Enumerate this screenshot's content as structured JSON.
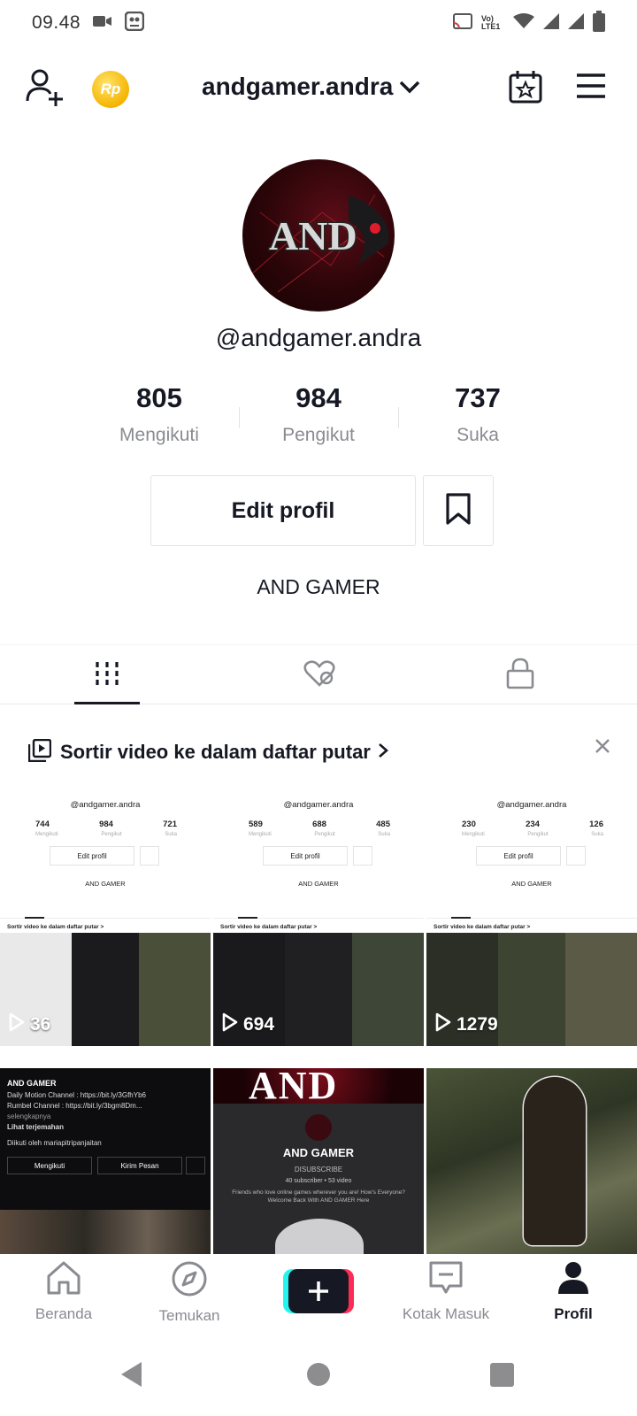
{
  "status_bar": {
    "time": "09.48",
    "network_label": "Vo) LTE1"
  },
  "header": {
    "username": "andgamer.andra",
    "coin_label": "Rp"
  },
  "profile": {
    "avatar_text": "AND",
    "handle": "@andgamer.andra",
    "stats": [
      {
        "value": "805",
        "label": "Mengikuti"
      },
      {
        "value": "984",
        "label": "Pengikut"
      },
      {
        "value": "737",
        "label": "Suka"
      }
    ],
    "edit_button_label": "Edit profil",
    "bio": "AND GAMER"
  },
  "playlist_banner": {
    "text": "Sortir video ke dalam daftar putar"
  },
  "videos": [
    {
      "views": "36",
      "mini": {
        "handle": "@andgamer.andra",
        "stats": [
          "744",
          "984",
          "721"
        ],
        "labels": [
          "Mengikuti",
          "Pengikut",
          "Suka"
        ],
        "edit": "Edit profil",
        "bio": "AND GAMER",
        "sort": "Sortir video ke dalam daftar putar >"
      }
    },
    {
      "views": "694",
      "mini": {
        "handle": "@andgamer.andra",
        "stats": [
          "589",
          "688",
          "485"
        ],
        "labels": [
          "Mengikuti",
          "Pengikut",
          "Suka"
        ],
        "edit": "Edit profil",
        "bio": "AND GAMER",
        "sort": "Sortir video ke dalam daftar putar >"
      }
    },
    {
      "views": "1279",
      "mini": {
        "handle": "@andgamer.andra",
        "stats": [
          "230",
          "234",
          "126"
        ],
        "labels": [
          "Mengikuti",
          "Pengikut",
          "Suka"
        ],
        "edit": "Edit profil",
        "bio": "AND GAMER",
        "sort": "Sortir video ke dalam daftar putar >"
      }
    },
    {
      "channel": {
        "title": "AND GAMER",
        "lines": [
          "Daily Motion Channel : https://bit.ly/3GfhYb6",
          "Rumbel Channel : https://bit.ly/3bgm8Dm...",
          "selengkapnya",
          "Lihat terjemahan",
          "Diikuti oleh mariapitripanjaitan"
        ],
        "follow_label": "Mengikuti",
        "message_label": "Kirim Pesan"
      }
    },
    {
      "yt": {
        "banner_text": "AND",
        "name": "AND GAMER",
        "subscribe": "DISUBSCRIBE",
        "counts": "40 subscriber • 53 video",
        "about": "Friends who love online games wherever you are! How's Everyone? Welcome Back With AND GAMER Here"
      }
    },
    {
      "gameplay": true
    }
  ],
  "bottom_nav": {
    "items": [
      {
        "label": "Beranda"
      },
      {
        "label": "Temukan"
      },
      {
        "label": "Kotak Masuk"
      },
      {
        "label": "Profil"
      }
    ]
  },
  "colors": {
    "text": "#161823",
    "muted": "#8a8b91",
    "accent_red": "#fe2c55",
    "accent_cyan": "#25f4ee",
    "coin": "#f5b400"
  }
}
